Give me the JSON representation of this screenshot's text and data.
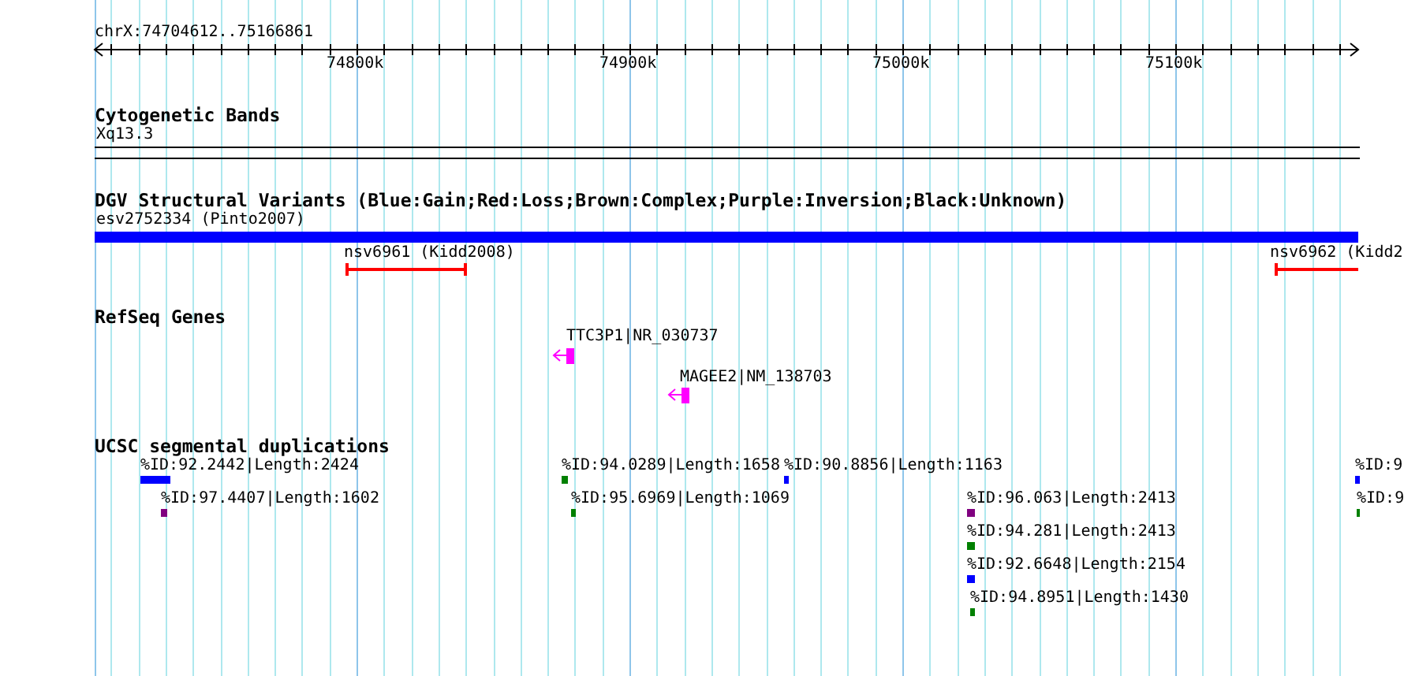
{
  "ruler": {
    "range": "chrX:74704612..75166861",
    "ticks": [
      "74800k",
      "74900k",
      "75000k",
      "75100k"
    ]
  },
  "tracks": [
    {
      "kind": "band",
      "title": "Cytogenetic Bands",
      "features": [
        {
          "label": "Xq13.3"
        }
      ]
    },
    {
      "kind": "variant",
      "title": "DGV Structural Variants (Blue:Gain;Red:Loss;Brown:Complex;Purple:Inversion;Black:Unknown)",
      "features": [
        {
          "label": "esv2752334 (Pinto2007)",
          "color": "#0000ff"
        },
        {
          "label": "nsv6961 (Kidd2008)",
          "color": "#ff0000"
        },
        {
          "label": "nsv6962 (Kidd2",
          "color": "#ff0000"
        }
      ]
    },
    {
      "kind": "gene",
      "title": "RefSeq Genes",
      "features": [
        {
          "label": "TTC3P1|NR_030737",
          "reverse": true
        },
        {
          "label": "MAGEE2|NM_138703",
          "reverse": true
        }
      ]
    },
    {
      "kind": "duplication",
      "title": "UCSC segmental duplications",
      "features": [
        {
          "label": "%ID:92.2442|Length:2424",
          "color": "#0000ff"
        },
        {
          "label": "%ID:97.4407|Length:1602",
          "color": "#800080"
        },
        {
          "label": "%ID:94.0289|Length:1658",
          "color": "#008000"
        },
        {
          "label": "%ID:95.6969|Length:1069",
          "color": "#008000"
        },
        {
          "label": "%ID:90.8856|Length:1163",
          "color": "#0000ff"
        },
        {
          "label": "%ID:96.063|Length:2413",
          "color": "#800080"
        },
        {
          "label": "%ID:94.281|Length:2413",
          "color": "#008000"
        },
        {
          "label": "%ID:92.6648|Length:2154",
          "color": "#0000ff"
        },
        {
          "label": "%ID:94.8951|Length:1430",
          "color": "#008000"
        },
        {
          "label": "%ID:9",
          "color": "#0000ff"
        },
        {
          "label": "%ID:9",
          "color": "#008000"
        }
      ]
    }
  ]
}
